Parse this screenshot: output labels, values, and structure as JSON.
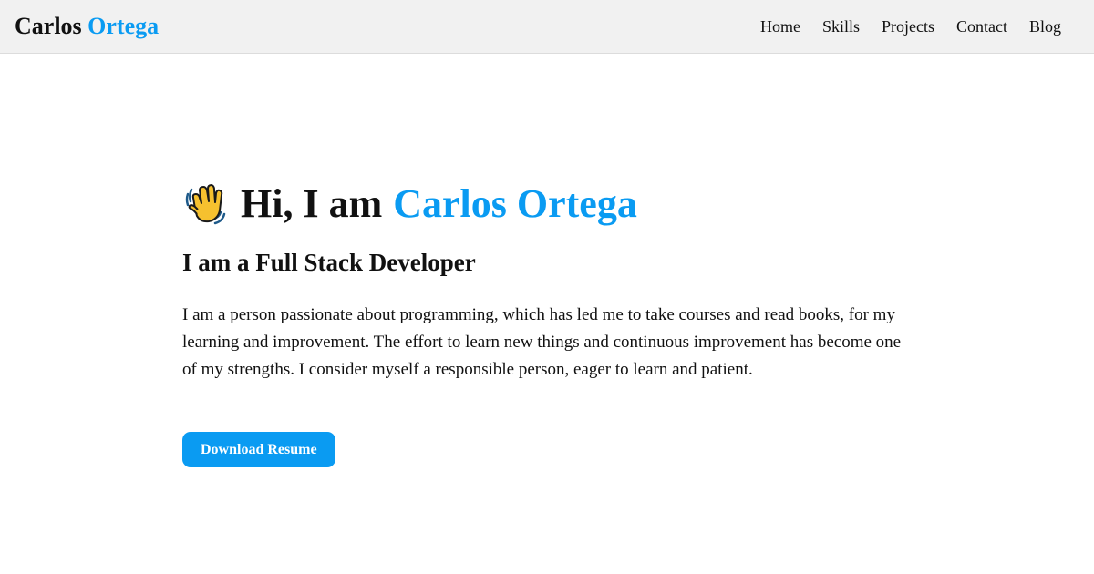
{
  "navbar": {
    "brand_first": "Carlos",
    "brand_last": "Ortega",
    "links": [
      "Home",
      "Skills",
      "Projects",
      "Contact",
      "Blog"
    ]
  },
  "hero": {
    "greeting": "Hi, I am",
    "name": "Carlos Ortega",
    "subtitle": "I am a Full Stack Developer",
    "bio": "I am a person passionate about programming, which has led me to take courses and read books, for my learning and improvement. The effort to learn new things and continuous improvement has become one of my strengths. I consider myself a responsible person, eager to learn and patient.",
    "button_label": "Download Resume"
  },
  "icons": {
    "greeting_icon": "waving-hand-icon"
  },
  "colors": {
    "accent": "#0a9bf2",
    "nav_background": "#f1f1f1",
    "text": "#111111"
  }
}
